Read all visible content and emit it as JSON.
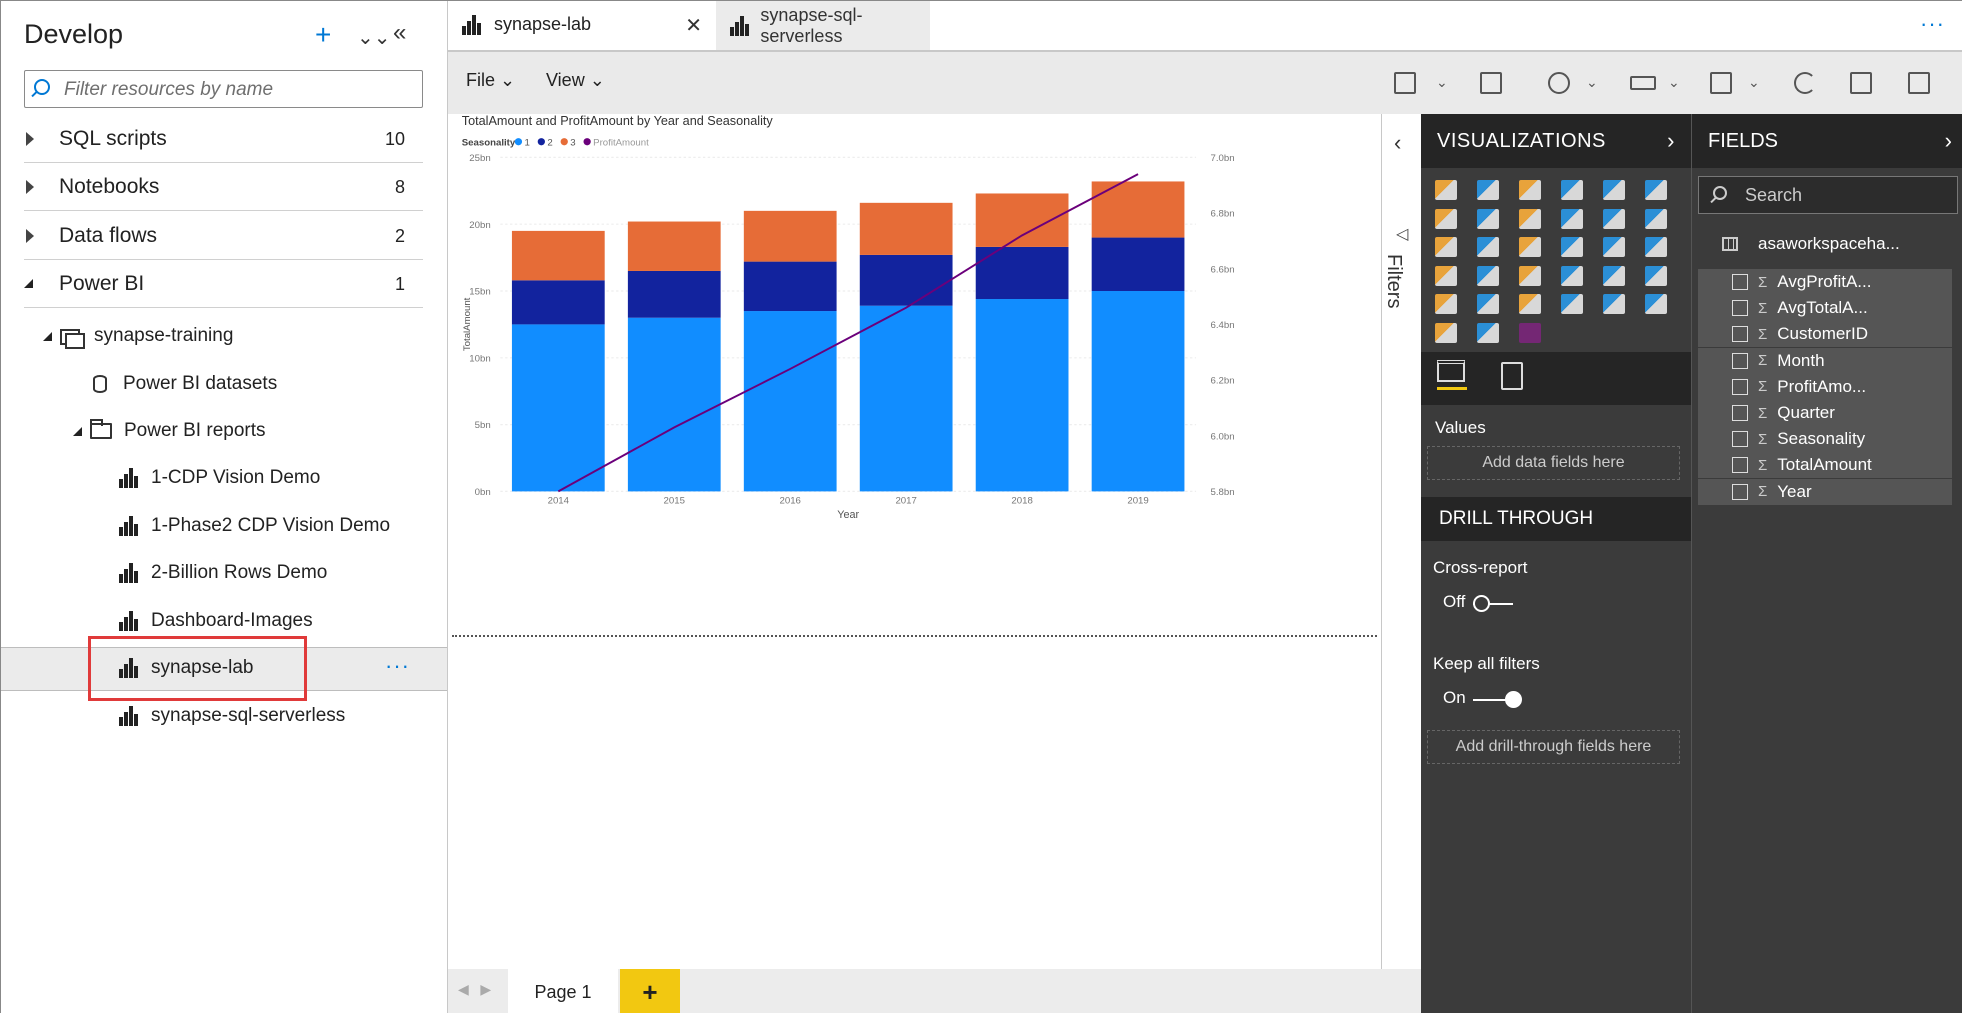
{
  "develop": {
    "title": "Develop",
    "search_placeholder": "Filter resources by name",
    "categories": [
      {
        "label": "SQL scripts",
        "count": "10"
      },
      {
        "label": "Notebooks",
        "count": "8"
      },
      {
        "label": "Data flows",
        "count": "2"
      },
      {
        "label": "Power BI",
        "count": "1"
      }
    ],
    "workspace": "synapse-training",
    "datasets": "Power BI datasets",
    "reports_folder": "Power BI reports",
    "reports": [
      "1-CDP Vision Demo",
      "1-Phase2 CDP Vision Demo",
      "2-Billion Rows Demo",
      "Dashboard-Images",
      "synapse-lab",
      "synapse-sql-serverless"
    ],
    "more_dots": "···"
  },
  "tabs": [
    {
      "label": "synapse-lab",
      "active": true
    },
    {
      "label": "synapse-sql-serverless",
      "active": false
    }
  ],
  "tab_more": "···",
  "toolbar": {
    "file": "File",
    "view": "View"
  },
  "chart_data": {
    "type": "bar",
    "title": "TotalAmount and ProfitAmount by Year and Seasonality",
    "legend_title": "Seasonality",
    "categories": [
      "2014",
      "2015",
      "2016",
      "2017",
      "2018",
      "2019"
    ],
    "series": [
      {
        "name": "1",
        "values": [
          12.5,
          13.0,
          13.5,
          13.9,
          14.4,
          15.0
        ],
        "color": "#118dff"
      },
      {
        "name": "2",
        "values": [
          3.3,
          3.5,
          3.7,
          3.8,
          3.9,
          4.0
        ],
        "color": "#12239e"
      },
      {
        "name": "3",
        "values": [
          3.7,
          3.7,
          3.8,
          3.9,
          4.0,
          4.2
        ],
        "color": "#e66c37"
      }
    ],
    "line": {
      "name": "ProfitAmount",
      "values": [
        5.8,
        6.03,
        6.24,
        6.46,
        6.72,
        6.94
      ],
      "color": "#6b007b"
    },
    "xlabel": "Year",
    "ylabel": "TotalAmount",
    "ylim": [
      0,
      25
    ],
    "y_ticks": [
      "0bn",
      "5bn",
      "10bn",
      "15bn",
      "20bn",
      "25bn"
    ],
    "y2lim": [
      5.8,
      7.0
    ],
    "y2_ticks": [
      "5.8bn",
      "6.0bn",
      "6.2bn",
      "6.4bn",
      "6.6bn",
      "6.8bn",
      "7.0bn"
    ],
    "stacked": true
  },
  "filters_label": "Filters",
  "page": {
    "label": "Page 1",
    "add": "+"
  },
  "visualizations": {
    "title": "VISUALIZATIONS",
    "values_label": "Values",
    "values_drop": "Add data fields here",
    "drill_title": "DRILL THROUGH",
    "cross_report": "Cross-report",
    "cross_report_state": "Off",
    "keep_filters": "Keep all filters",
    "keep_filters_state": "On",
    "drill_drop": "Add drill-through fields here"
  },
  "fields": {
    "title": "FIELDS",
    "search_placeholder": "Search",
    "table": "asaworkspaceha...",
    "items": [
      "AvgProfitA...",
      "AvgTotalA...",
      "CustomerID",
      "Month",
      "ProfitAmo...",
      "Quarter",
      "Seasonality",
      "TotalAmount",
      "Year"
    ],
    "sigma": "Σ"
  }
}
